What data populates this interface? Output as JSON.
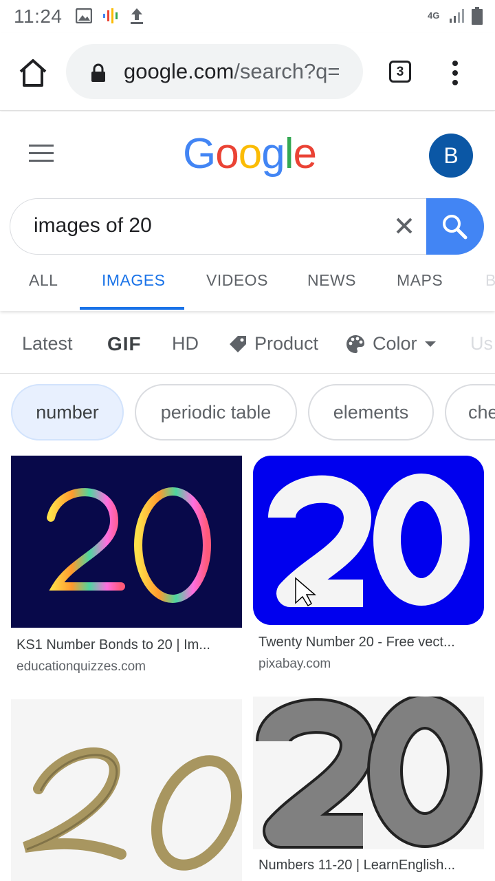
{
  "status_bar": {
    "time": "11:24",
    "network": "4G"
  },
  "browser": {
    "url_main": "google.com",
    "url_rest": "/search?q=",
    "tab_count": "3"
  },
  "google": {
    "logo_letters": [
      "G",
      "o",
      "o",
      "g",
      "l",
      "e"
    ],
    "logo_colors": [
      "#4285f4",
      "#ea4335",
      "#fbbc05",
      "#4285f4",
      "#34a853",
      "#ea4335"
    ],
    "avatar_letter": "B",
    "query": "images of 20"
  },
  "nav_tabs": [
    {
      "label": "ALL"
    },
    {
      "label": "IMAGES"
    },
    {
      "label": "VIDEOS"
    },
    {
      "label": "NEWS"
    },
    {
      "label": "MAPS"
    },
    {
      "label": "B"
    }
  ],
  "filters": [
    {
      "label": "Latest"
    },
    {
      "label": "GIF"
    },
    {
      "label": "HD"
    },
    {
      "label": "Product",
      "icon": "tag-icon"
    },
    {
      "label": "Color",
      "icon": "palette-icon"
    },
    {
      "label": "Us"
    }
  ],
  "chips": [
    {
      "label": "number",
      "selected": true
    },
    {
      "label": "periodic table"
    },
    {
      "label": "elements"
    },
    {
      "label": "che"
    }
  ],
  "results": [
    {
      "title": "KS1 Number Bonds to 20 | Im...",
      "source": "educationquizzes.com"
    },
    {
      "title": "Twenty Number 20 - Free vect...",
      "source": "pixabay.com"
    },
    {
      "title": "",
      "source": ""
    },
    {
      "title": "Numbers 11-20 | LearnEnglish...",
      "source": ""
    }
  ],
  "colors": {
    "accent": "#1a73e8",
    "search_button": "#4285f4",
    "chip_selected": "#e8f0fe"
  }
}
